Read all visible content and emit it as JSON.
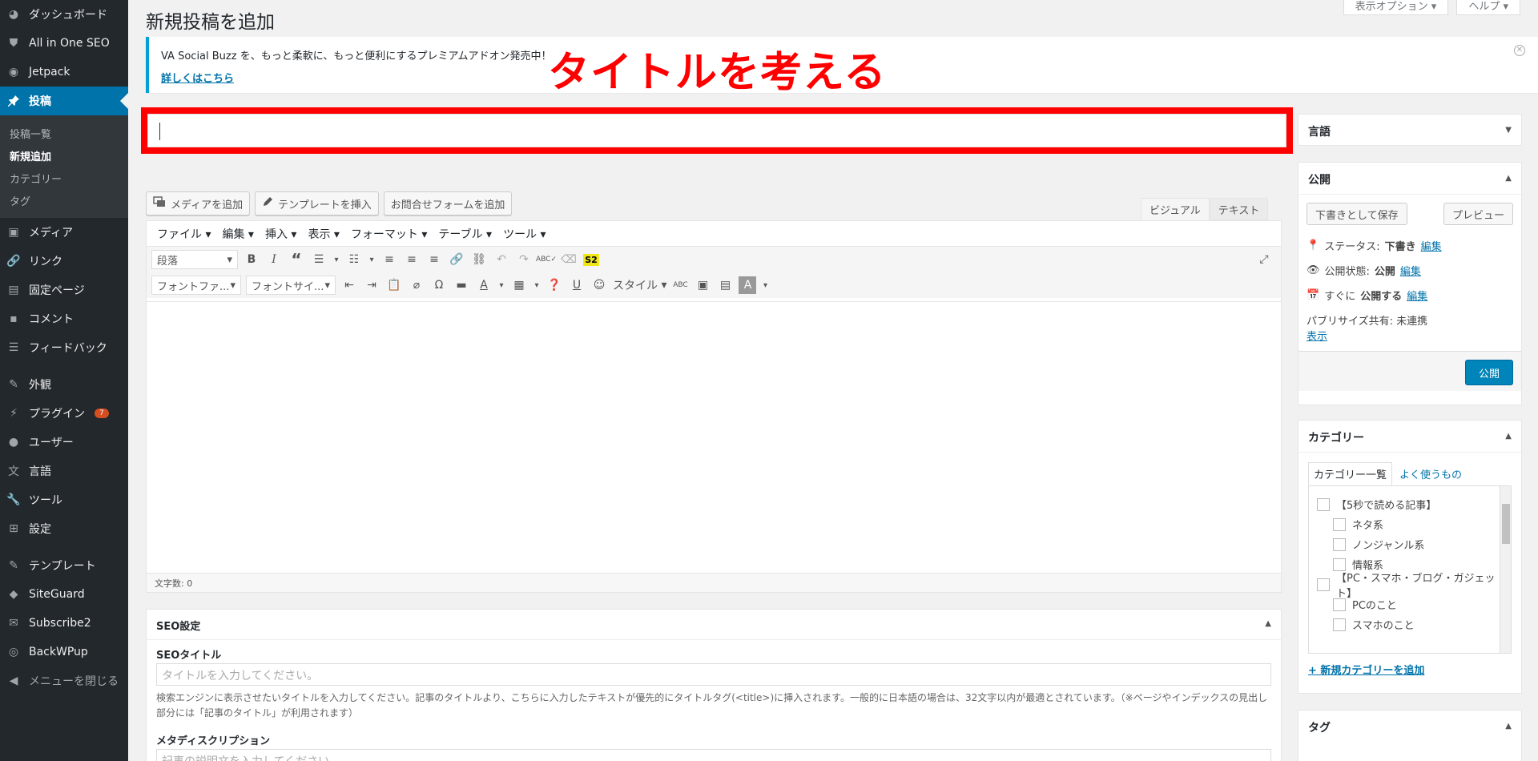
{
  "sidebar": {
    "items_top": [
      {
        "label": "ダッシュボード",
        "icon": "dashboard-icon"
      },
      {
        "label": "All in One SEO",
        "icon": "shield-icon"
      },
      {
        "label": "Jetpack",
        "icon": "jetpack-icon"
      }
    ],
    "active": {
      "label": "投稿",
      "icon": "pin-icon"
    },
    "submenu": [
      "投稿一覧",
      "新規追加",
      "カテゴリー",
      "タグ"
    ],
    "items_mid": [
      {
        "label": "メディア",
        "icon": "media-icon"
      },
      {
        "label": "リンク",
        "icon": "link-icon"
      },
      {
        "label": "固定ページ",
        "icon": "page-icon"
      },
      {
        "label": "コメント",
        "icon": "comment-icon"
      },
      {
        "label": "フィードバック",
        "icon": "feedback-icon"
      }
    ],
    "items_low": [
      {
        "label": "外観",
        "icon": "brush-icon"
      },
      {
        "label": "プラグイン",
        "icon": "plugin-icon"
      },
      {
        "label": "ユーザー",
        "icon": "user-icon"
      },
      {
        "label": "言語",
        "icon": "language-icon"
      },
      {
        "label": "ツール",
        "icon": "wrench-icon"
      },
      {
        "label": "設定",
        "icon": "settings-icon"
      }
    ],
    "plugin_badge": "7",
    "items_bottom": [
      {
        "label": "テンプレート",
        "icon": "pencil-icon"
      },
      {
        "label": "SiteGuard",
        "icon": "siteguard-icon"
      },
      {
        "label": "Subscribe2",
        "icon": "subscribe-icon"
      },
      {
        "label": "BackWPup",
        "icon": "backwpup-icon"
      },
      {
        "label": "メニューを閉じる",
        "icon": "collapse-icon"
      }
    ]
  },
  "header": {
    "title": "新規投稿を追加",
    "screen_options": "表示オプション ▾",
    "help": "ヘルプ ▾"
  },
  "notice": {
    "text": "VA Social Buzz を、もっと柔軟に、もっと便利にするプレミアムアドオン発売中！",
    "link": "詳しくはこちら"
  },
  "annotation": "タイトルを考える",
  "media_buttons": [
    "メディアを追加",
    "テンプレートを挿入",
    "お問合せフォームを追加"
  ],
  "editor_tabs": [
    "ビジュアル",
    "テキスト"
  ],
  "menubar": [
    "ファイル",
    "編集",
    "挿入",
    "表示",
    "フォーマット",
    "テーブル",
    "ツール"
  ],
  "toolbar": {
    "format": "段落",
    "font_family": "フォントファ...",
    "font_size": "フォントサイ...",
    "style": "スタイル",
    "s2": "S2"
  },
  "word_count": "文字数: 0",
  "seo": {
    "heading": "SEO設定",
    "title_label": "SEOタイトル",
    "title_placeholder": "タイトルを入力してください。",
    "title_desc": "検索エンジンに表示させたいタイトルを入力してください。記事のタイトルより、こちらに入力したテキストが優先的にタイトルタグ(<title>)に挿入されます。一般的に日本語の場合は、32文字以内が最適とされています。（※ページやインデックスの見出し部分には「記事のタイトル」が利用されます）",
    "meta_label": "メタディスクリプション",
    "meta_placeholder": "記事の説明文を入力してください。"
  },
  "language_box": {
    "title": "言語"
  },
  "publish_box": {
    "title": "公開",
    "save_draft": "下書きとして保存",
    "preview": "プレビュー",
    "status_label": "ステータス:",
    "status_value": "下書き",
    "edit": "編集",
    "visibility_label": "公開状態:",
    "visibility_value": "公開",
    "schedule_label": "すぐに",
    "schedule_value": "公開する",
    "publicize": "パブリサイズ共有: 未連携",
    "show": "表示",
    "publish": "公開"
  },
  "category_box": {
    "title": "カテゴリー",
    "tab_all": "カテゴリー一覧",
    "tab_popular": "よく使うもの",
    "items": [
      {
        "label": "【5秒で読める記事】",
        "level": 0
      },
      {
        "label": "ネタ系",
        "level": 1
      },
      {
        "label": "ノンジャンル系",
        "level": 1
      },
      {
        "label": "情報系",
        "level": 1
      },
      {
        "label": "【PC・スマホ・ブログ・ガジェット】",
        "level": 0
      },
      {
        "label": "PCのこと",
        "level": 1
      },
      {
        "label": "スマホのこと",
        "level": 1
      }
    ],
    "add_new": "+ 新規カテゴリーを追加"
  },
  "tag_box": {
    "title": "タグ"
  },
  "colors": {
    "sidebar": "#23282d",
    "accent": "#0073aa",
    "annotation": "#ff0000",
    "publish": "#0085ba"
  }
}
